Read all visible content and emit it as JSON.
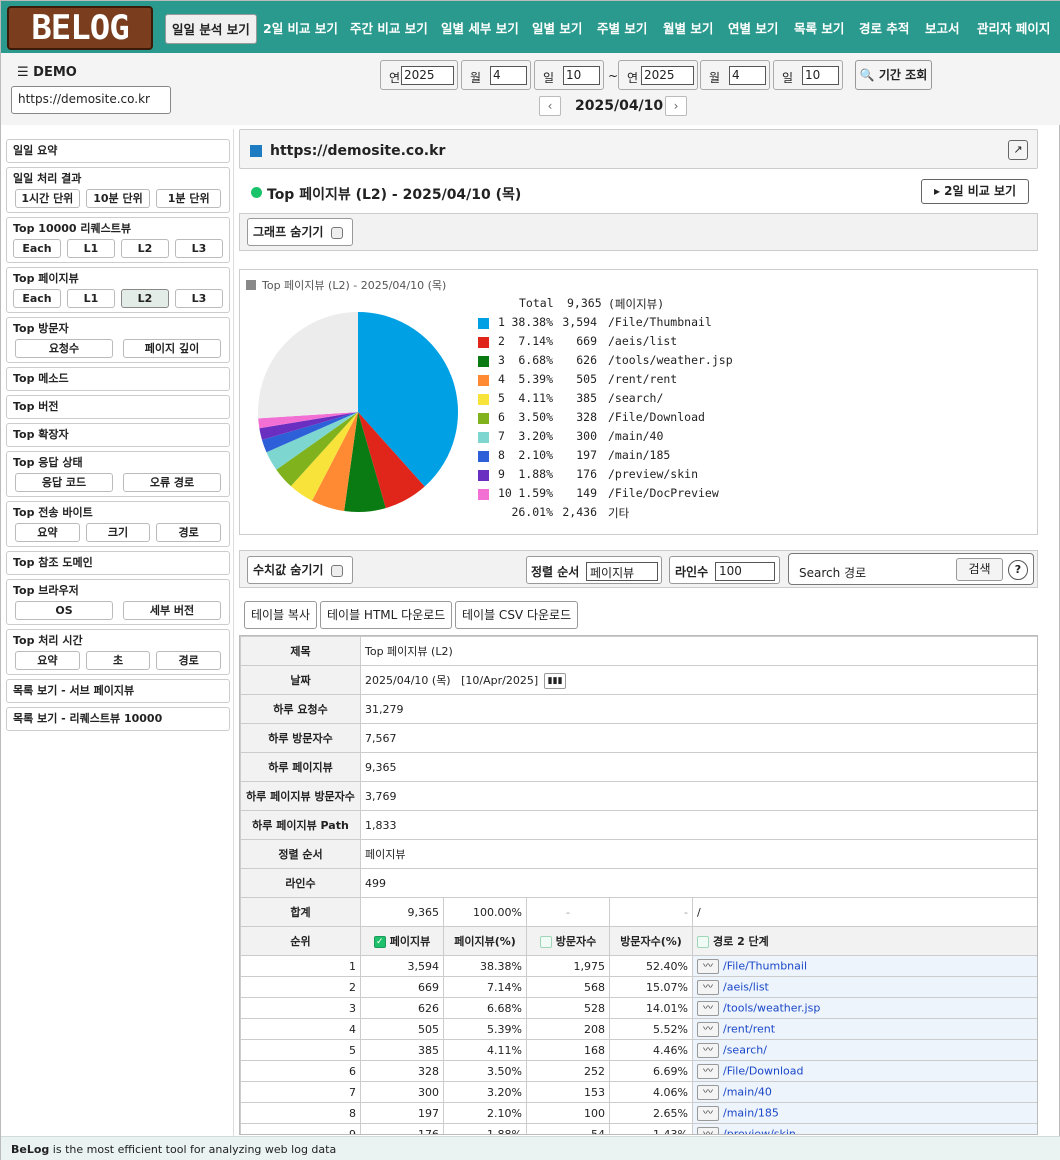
{
  "logo": "BELOG",
  "nav": [
    "일일 분석 보기",
    "2일 비교 보기",
    "주간 비교 보기",
    "일별 세부 보기",
    "일별 보기",
    "주별 보기",
    "월별 보기",
    "연별 보기",
    "목록 보기",
    "경로 추적",
    "보고서",
    "관리자 페이지"
  ],
  "demo": "☰ DEMO",
  "site": "https://demosite.co.kr",
  "date_from": {
    "year_label": "연",
    "year": "2025",
    "month_label": "월",
    "month": "4",
    "day_label": "일",
    "day": "10"
  },
  "date_to": {
    "year_label": "연",
    "year": "2025",
    "month_label": "월",
    "month": "4",
    "day_label": "일",
    "day": "10"
  },
  "tilde": "~",
  "query_label": "기간 조회",
  "current_date": "2025/04/10",
  "sidebar": {
    "daily_summary": "일일 요약",
    "daily_result": {
      "title": "일일 처리 결과",
      "buttons": [
        "1시간 단위",
        "10분 단위",
        "1분 단위"
      ]
    },
    "top_request": {
      "title": "Top 10000 리퀘스트뷰",
      "buttons": [
        "Each",
        "L1",
        "L2",
        "L3"
      ]
    },
    "top_pageview": {
      "title": "Top 페이지뷰",
      "buttons": [
        "Each",
        "L1",
        "L2",
        "L3"
      ],
      "selected": "L2"
    },
    "top_visitor": {
      "title": "Top 방문자",
      "buttons": [
        "요청수",
        "페이지 깊이"
      ]
    },
    "top_method": "Top 메소드",
    "top_version": "Top 버전",
    "top_ext": "Top 확장자",
    "top_status": {
      "title": "Top 응답 상태",
      "buttons": [
        "응답 코드",
        "오류 경로"
      ]
    },
    "top_bytes": {
      "title": "Top 전송 바이트",
      "buttons": [
        "요약",
        "크기",
        "경로"
      ]
    },
    "top_ref": "Top 참조 도메인",
    "top_browser": {
      "title": "Top 브라우저",
      "buttons": [
        "OS",
        "세부 버전"
      ]
    },
    "top_time": {
      "title": "Top 처리 시간",
      "buttons": [
        "요약",
        "초",
        "경로"
      ]
    },
    "list_sub": "목록 보기 - 서브 페이지뷰",
    "list_req": "목록 보기 - 리퀘스트뷰 10000"
  },
  "main": {
    "url": "https://demosite.co.kr",
    "ext_icon": "↗",
    "title": "Top 페이지뷰 (L2) - 2025/04/10 (목)",
    "compare_btn": "▸ 2일 비교 보기",
    "hide_graph": "그래프 숨기기",
    "hide_values": "수치값 숨기기",
    "sort_label": "정렬 순서",
    "sort_value": "페이지뷰",
    "lines_label": "라인수",
    "lines_value": "100",
    "search_placeholder": "Search 경로",
    "search_btn": "검색",
    "help": "?",
    "table_copy": "테이블 복사",
    "table_html": "테이블 HTML 다운로드",
    "table_csv": "테이블 CSV 다운로드"
  },
  "chart_data": {
    "type": "pie",
    "title": "Top 페이지뷰 (L2) - 2025/04/10 (목)",
    "total_label": "Total",
    "total": "9,365",
    "unit": "(페이지뷰)",
    "slices": [
      {
        "rank": "1",
        "pct": "38.38%",
        "count": "3,594",
        "path": "/File/Thumbnail",
        "color": "#00a0e4",
        "value": 38.38
      },
      {
        "rank": "2",
        "pct": "7.14%",
        "count": "669",
        "path": "/aeis/list",
        "color": "#e0261a",
        "value": 7.14
      },
      {
        "rank": "3",
        "pct": "6.68%",
        "count": "626",
        "path": "/tools/weather.jsp",
        "color": "#0a7a12",
        "value": 6.68
      },
      {
        "rank": "4",
        "pct": "5.39%",
        "count": "505",
        "path": "/rent/rent",
        "color": "#ff8a33",
        "value": 5.39
      },
      {
        "rank": "5",
        "pct": "4.11%",
        "count": "385",
        "path": "/search/",
        "color": "#f8e33a",
        "value": 4.11
      },
      {
        "rank": "6",
        "pct": "3.50%",
        "count": "328",
        "path": "/File/Download",
        "color": "#7fb21c",
        "value": 3.5
      },
      {
        "rank": "7",
        "pct": "3.20%",
        "count": "300",
        "path": "/main/40",
        "color": "#7ed6d0",
        "value": 3.2
      },
      {
        "rank": "8",
        "pct": "2.10%",
        "count": "197",
        "path": "/main/185",
        "color": "#2d5fd8",
        "value": 2.1
      },
      {
        "rank": "9",
        "pct": "1.88%",
        "count": "176",
        "path": "/preview/skin",
        "color": "#6a2fc0",
        "value": 1.88
      },
      {
        "rank": "10",
        "pct": "1.59%",
        "count": "149",
        "path": "/File/DocPreview",
        "color": "#f26fd4",
        "value": 1.59
      },
      {
        "rank": "",
        "pct": "26.01%",
        "count": "2,436",
        "path": "기타",
        "color": "#ececec",
        "value": 26.01
      }
    ]
  },
  "info": [
    {
      "k": "제목",
      "v": "Top 페이지뷰 (L2)"
    },
    {
      "k": "날짜",
      "v": "2025/04/10 (목)   [10/Apr/2025]"
    },
    {
      "k": "하루 요청수",
      "v": "31,279"
    },
    {
      "k": "하루 방문자수",
      "v": "7,567"
    },
    {
      "k": "하루 페이지뷰",
      "v": "9,365"
    },
    {
      "k": "하루 페이지뷰 방문자수",
      "v": "3,769"
    },
    {
      "k": "하루 페이지뷰 Path",
      "v": "1,833"
    },
    {
      "k": "정렬 순서",
      "v": "페이지뷰"
    },
    {
      "k": "라인수",
      "v": "499"
    }
  ],
  "sum_row": {
    "k": "합계",
    "pv": "9,365",
    "pvp": "100.00%",
    "vis": "-",
    "visp": "-",
    "path": "/"
  },
  "headers": {
    "rank": "순위",
    "pv": "페이지뷰",
    "pvp": "페이지뷰(%)",
    "vis": "방문자수",
    "visp": "방문자수(%)",
    "path": "경로 2 단계"
  },
  "rows": [
    {
      "rank": "1",
      "pv": "3,594",
      "pvp": "38.38%",
      "vis": "1,975",
      "visp": "52.40%",
      "path": "/File/Thumbnail"
    },
    {
      "rank": "2",
      "pv": "669",
      "pvp": "7.14%",
      "vis": "568",
      "visp": "15.07%",
      "path": "/aeis/list"
    },
    {
      "rank": "3",
      "pv": "626",
      "pvp": "6.68%",
      "vis": "528",
      "visp": "14.01%",
      "path": "/tools/weather.jsp"
    },
    {
      "rank": "4",
      "pv": "505",
      "pvp": "5.39%",
      "vis": "208",
      "visp": "5.52%",
      "path": "/rent/rent"
    },
    {
      "rank": "5",
      "pv": "385",
      "pvp": "4.11%",
      "vis": "168",
      "visp": "4.46%",
      "path": "/search/"
    },
    {
      "rank": "6",
      "pv": "328",
      "pvp": "3.50%",
      "vis": "252",
      "visp": "6.69%",
      "path": "/File/Download"
    },
    {
      "rank": "7",
      "pv": "300",
      "pvp": "3.20%",
      "vis": "153",
      "visp": "4.06%",
      "path": "/main/40"
    },
    {
      "rank": "8",
      "pv": "197",
      "pvp": "2.10%",
      "vis": "100",
      "visp": "2.65%",
      "path": "/main/185"
    },
    {
      "rank": "9",
      "pv": "176",
      "pvp": "1.88%",
      "vis": "54",
      "visp": "1.43%",
      "path": "/preview/skin"
    }
  ],
  "footer": {
    "brand": "BeLog",
    "text": " is the most efficient tool for analyzing web log data"
  }
}
